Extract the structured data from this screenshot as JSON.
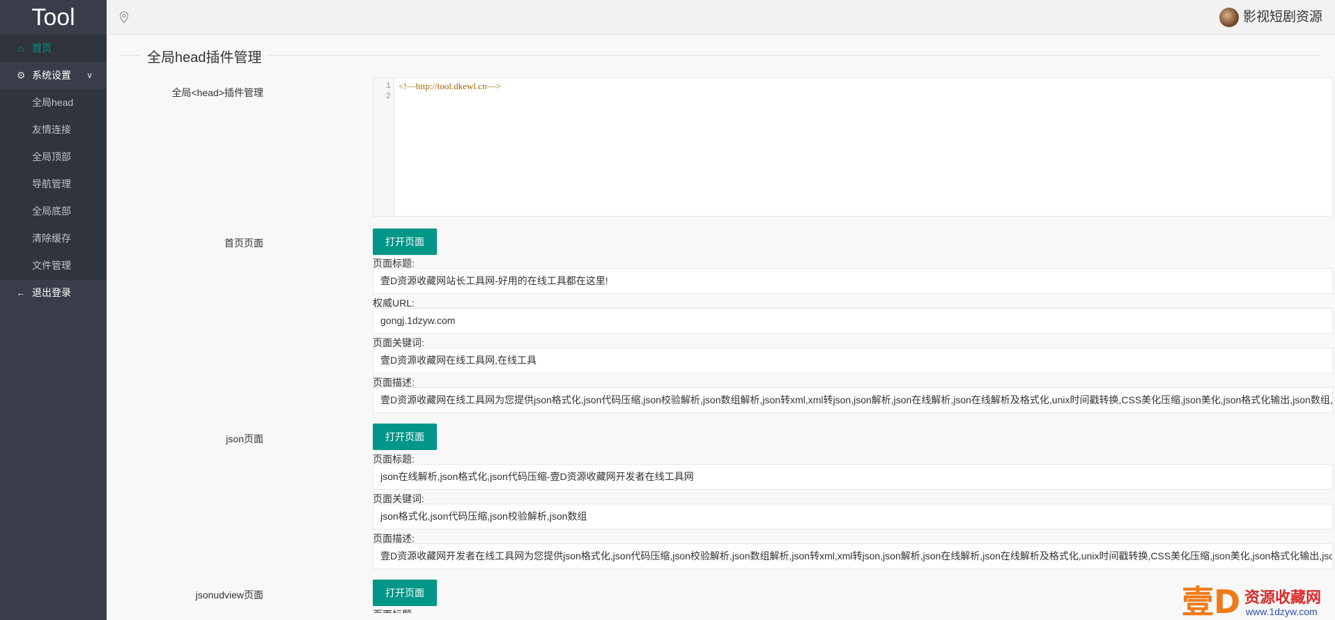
{
  "app": {
    "logo": "Tool"
  },
  "sidebar": {
    "home": "首页",
    "settings": "系统设置",
    "sub_items": [
      "全局head",
      "友情连接",
      "全局顶部",
      "导航管理",
      "全局底部",
      "清除缓存",
      "文件管理"
    ],
    "logout": "退出登录"
  },
  "header": {
    "user_name": "影视短剧资源"
  },
  "main": {
    "legend": "全局head插件管理",
    "head_label": "全局<head>插件管理",
    "editor": {
      "line_numbers": [
        "1",
        "2"
      ],
      "line1": "<!—http://tool.dkewl.cn—>"
    },
    "open_label": "打开页面",
    "field_title": "页面标题:",
    "field_url": "权威URL:",
    "field_keywords": "页面关键词:",
    "field_desc": "页面描述:",
    "home": {
      "label": "首页页面",
      "title": "壹D资源收藏网站长工具网-好用的在线工具都在这里!",
      "url": "gongj.1dzyw.com",
      "keywords": "壹D资源收藏网在线工具网,在线工具",
      "desc": "壹D资源收藏网在线工具网为您提供json格式化,json代码压缩,json校验解析,json数组解析,json转xml,xml转json,json解析,json在线解析,json在线解析及格式化,unix时间戳转换,CSS美化压缩,json美化,json格式化输出,json数组,"
    },
    "json": {
      "label": "json页面",
      "title": "json在线解析,json格式化,json代码压缩-壹D资源收藏网开发者在线工具网",
      "keywords": "json格式化,json代码压缩,json校验解析,json数组",
      "desc": "壹D资源收藏网开发者在线工具网为您提供json格式化,json代码压缩,json校验解析,json数组解析,json转xml,xml转json,json解析,json在线解析,json在线解析及格式化,unix时间戳转换,CSS美化压缩,json美化,json格式化输出,jso"
    },
    "jsonudview": {
      "label": "jsonudview页面",
      "partial_label": "页面标题"
    }
  },
  "watermark": {
    "big": "壹D",
    "top": "资源收藏网",
    "url": "www.1dzyw.com"
  }
}
